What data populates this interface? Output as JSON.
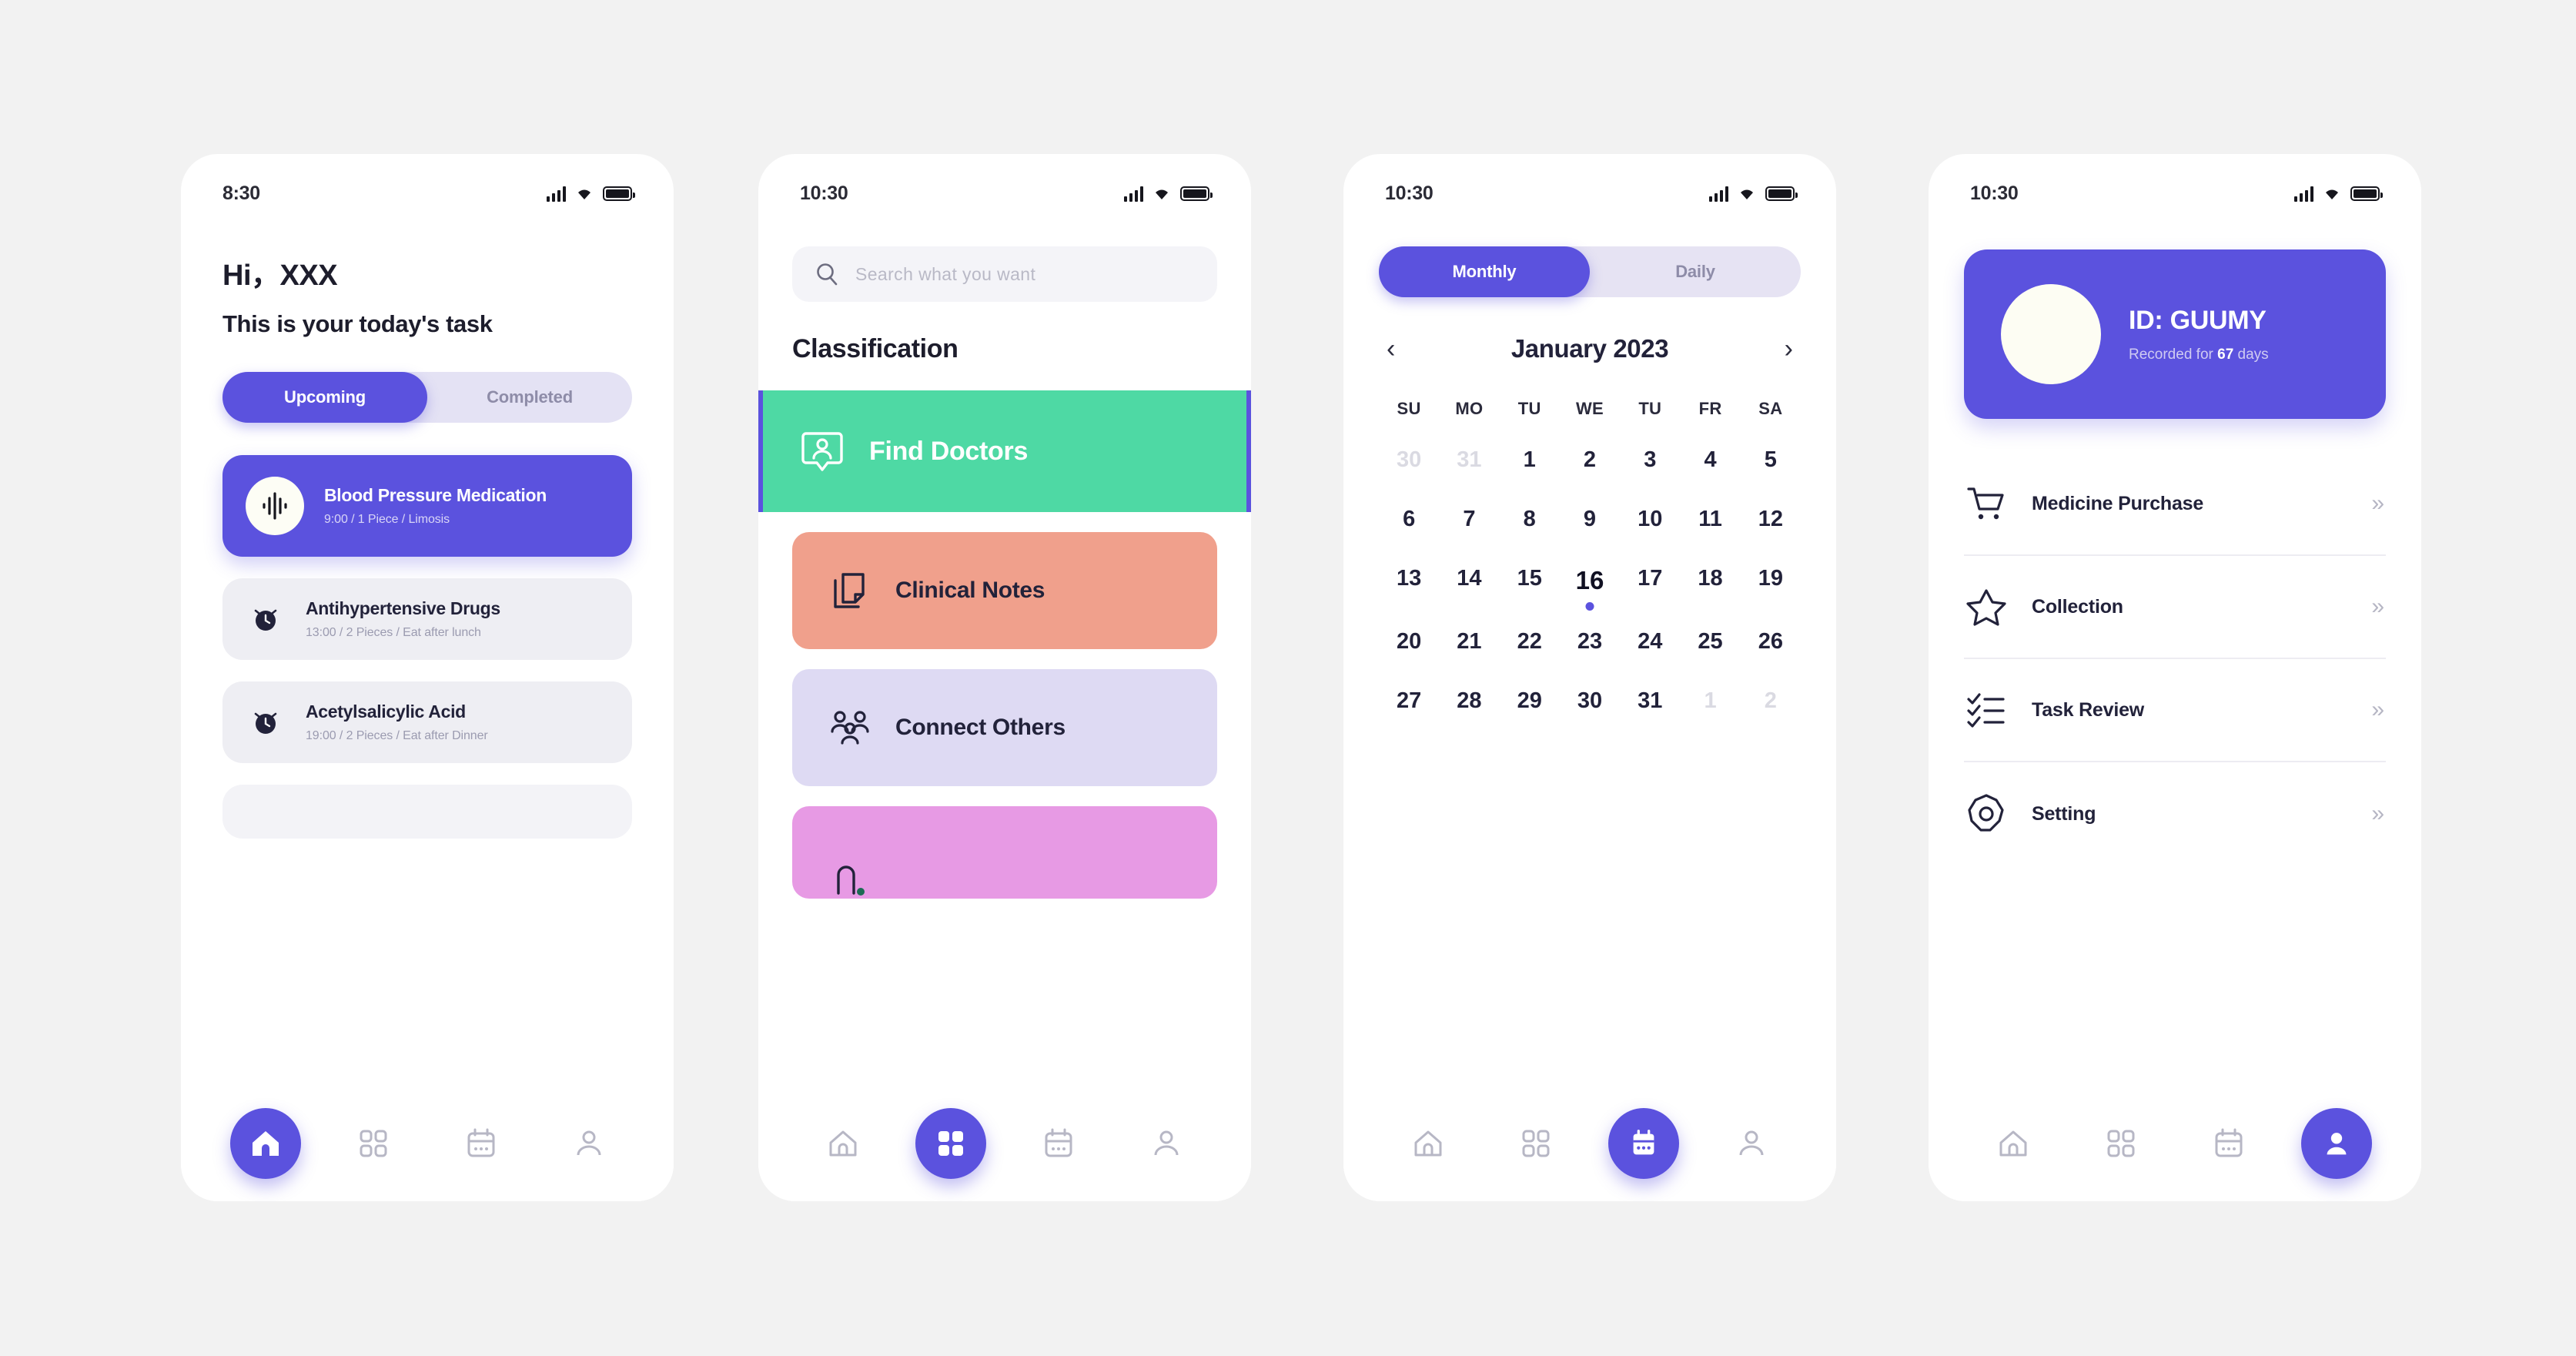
{
  "canvas": {
    "background": "#f2f2f2"
  },
  "theme": {
    "accent": "#5b52de",
    "green": "#4ed9a4",
    "salmon": "#f0a08c",
    "lavender": "#dedaf3",
    "magenta": "#e79ae4",
    "muted_text": "#9b9bb0"
  },
  "screens": [
    {
      "name": "home",
      "statusbar": {
        "time": "8:30",
        "signal_icon": "signal-bars-icon",
        "wifi_icon": "wifi-icon",
        "battery_icon": "battery-icon"
      },
      "greeting": "Hi，XXX",
      "subtitle": "This is your today's task",
      "tabs": [
        {
          "label": "Upcoming",
          "active": true
        },
        {
          "label": "Completed",
          "active": false
        }
      ],
      "tasks": [
        {
          "icon": "pulse-icon",
          "title": "Blood Pressure Medication",
          "detail": "9:00 / 1 Piece / Limosis",
          "primary": true
        },
        {
          "icon": "alarm-clock-icon",
          "title": "Antihypertensive Drugs",
          "detail": "13:00 / 2 Pieces / Eat after lunch",
          "primary": false
        },
        {
          "icon": "alarm-clock-icon",
          "title": "Acetylsalicylic Acid",
          "detail": "19:00 / 2 Pieces / Eat after Dinner",
          "primary": false
        }
      ],
      "nav_active": "home"
    },
    {
      "name": "classification",
      "statusbar": {
        "time": "10:30",
        "signal_icon": "signal-bars-icon",
        "wifi_icon": "wifi-icon",
        "battery_icon": "battery-icon"
      },
      "search": {
        "placeholder": "Search what you want",
        "icon": "search-icon",
        "value": ""
      },
      "heading": "Classification",
      "categories": [
        {
          "label": "Find Doctors",
          "icon": "doctor-badge-icon",
          "color": "#4ed9a4",
          "featured": true
        },
        {
          "label": "Clinical Notes",
          "icon": "notes-icon",
          "color": "#f0a08c",
          "featured": false
        },
        {
          "label": "Connect Others",
          "icon": "people-group-icon",
          "color": "#dedaf3",
          "featured": false
        },
        {
          "label": "",
          "icon": "partial-icon",
          "color": "#e79ae4",
          "featured": false
        }
      ],
      "nav_active": "grid"
    },
    {
      "name": "calendar",
      "statusbar": {
        "time": "10:30",
        "signal_icon": "signal-bars-icon",
        "wifi_icon": "wifi-icon",
        "battery_icon": "battery-icon"
      },
      "view_tabs": [
        {
          "label": "Monthly",
          "active": true
        },
        {
          "label": "Daily",
          "active": false
        }
      ],
      "month_label": "January 2023",
      "prev_icon": "chevron-left-icon",
      "next_icon": "chevron-right-icon",
      "weekdays": [
        "SU",
        "MO",
        "TU",
        "WE",
        "TU",
        "FR",
        "SA"
      ],
      "weeks": [
        [
          {
            "d": "30",
            "muted": true
          },
          {
            "d": "31",
            "muted": true
          },
          {
            "d": "1"
          },
          {
            "d": "2"
          },
          {
            "d": "3"
          },
          {
            "d": "4"
          },
          {
            "d": "5"
          }
        ],
        [
          {
            "d": "6"
          },
          {
            "d": "7"
          },
          {
            "d": "8"
          },
          {
            "d": "9"
          },
          {
            "d": "10"
          },
          {
            "d": "11"
          },
          {
            "d": "12"
          }
        ],
        [
          {
            "d": "13"
          },
          {
            "d": "14"
          },
          {
            "d": "15"
          },
          {
            "d": "16",
            "today": true
          },
          {
            "d": "17"
          },
          {
            "d": "18"
          },
          {
            "d": "19"
          }
        ],
        [
          {
            "d": "20"
          },
          {
            "d": "21"
          },
          {
            "d": "22"
          },
          {
            "d": "23"
          },
          {
            "d": "24"
          },
          {
            "d": "25"
          },
          {
            "d": "26"
          }
        ],
        [
          {
            "d": "27"
          },
          {
            "d": "28"
          },
          {
            "d": "29"
          },
          {
            "d": "30"
          },
          {
            "d": "31"
          },
          {
            "d": "1",
            "muted": true
          },
          {
            "d": "2",
            "muted": true
          }
        ]
      ],
      "nav_active": "calendar"
    },
    {
      "name": "profile",
      "statusbar": {
        "time": "10:30",
        "signal_icon": "signal-bars-icon",
        "wifi_icon": "wifi-icon",
        "battery_icon": "battery-icon"
      },
      "profile": {
        "avatar_icon": "avatar-placeholder",
        "id_label": "ID: GUUMY",
        "recorded_prefix": "Recorded for ",
        "recorded_count": "67",
        "recorded_suffix": " days"
      },
      "menu": [
        {
          "label": "Medicine Purchase",
          "icon": "shopping-cart-icon",
          "chevron": "»"
        },
        {
          "label": "Collection",
          "icon": "star-icon",
          "chevron": "»"
        },
        {
          "label": "Task Review",
          "icon": "checklist-icon",
          "chevron": "»"
        },
        {
          "label": "Setting",
          "icon": "gear-icon",
          "chevron": "»"
        }
      ],
      "nav_active": "profile"
    }
  ],
  "nav_items": [
    {
      "key": "home",
      "icon": "home-icon"
    },
    {
      "key": "grid",
      "icon": "grid-icon"
    },
    {
      "key": "calendar",
      "icon": "calendar-icon"
    },
    {
      "key": "profile",
      "icon": "person-icon"
    }
  ]
}
